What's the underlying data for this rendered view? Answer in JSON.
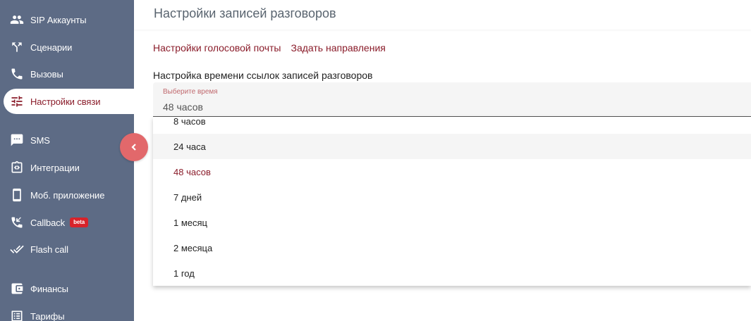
{
  "sidebar": {
    "items": [
      {
        "label": "SIP Аккаунты",
        "icon": "users-icon"
      },
      {
        "label": "Сценарии",
        "icon": "call-split-icon"
      },
      {
        "label": "Вызовы",
        "icon": "phone-icon"
      },
      {
        "label": "Настройки связи",
        "icon": "tune-icon",
        "active": true
      },
      {
        "label": "SMS",
        "icon": "sms-icon"
      },
      {
        "label": "Интеграции",
        "icon": "integration-icon"
      },
      {
        "label": "Моб. приложение",
        "icon": "smartphone-icon"
      },
      {
        "label": "Callback",
        "icon": "phone-callback-icon",
        "badge": "beta"
      },
      {
        "label": "Flash call",
        "icon": "double-check-icon"
      },
      {
        "label": "Финансы",
        "icon": "wallet-icon"
      },
      {
        "label": "Тарифы",
        "icon": "list-icon"
      }
    ]
  },
  "header": {
    "title": "Настройки записей разговоров"
  },
  "links": {
    "voicemail": "Настройки голосовой почты",
    "directions": "Задать направления"
  },
  "section": {
    "label": "Настройка времени ссылок записей разговоров"
  },
  "select": {
    "label": "Выберите время",
    "value": "48 часов"
  },
  "dropdown": {
    "options": [
      "8 часов",
      "24 часа",
      "48 часов",
      "7 дней",
      "1 месяц",
      "2 месяца",
      "1 год"
    ],
    "selected": "48 часов",
    "hovered": "24 часа"
  },
  "colors": {
    "sidebar_bg": "#5d6b85",
    "accent": "#8a1c2a",
    "collapse_button": "#e2686b",
    "beta_badge": "#d8232a"
  }
}
